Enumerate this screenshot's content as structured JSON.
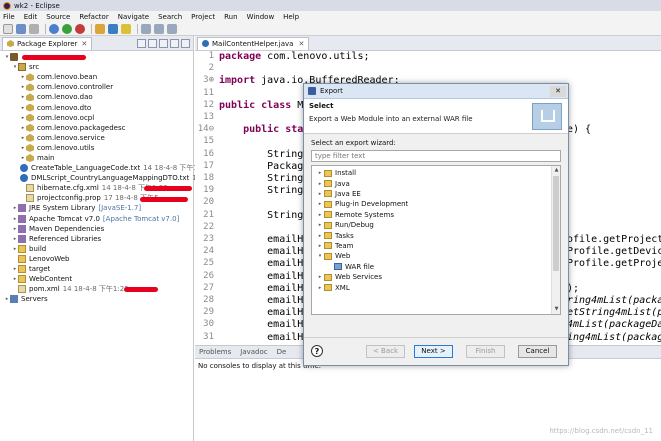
{
  "window": {
    "title": "wk2 - Eclipse"
  },
  "menu": [
    "File",
    "Edit",
    "Source",
    "Refactor",
    "Navigate",
    "Search",
    "Project",
    "Run",
    "Window",
    "Help"
  ],
  "explorer": {
    "tab_label": "Package Explorer",
    "tab_close": "✕",
    "rows": [
      {
        "depth": 0,
        "twisty": "▾",
        "icon": "project",
        "label": "",
        "meta": "",
        "redact": 64
      },
      {
        "depth": 1,
        "twisty": "▾",
        "icon": "src",
        "label": "src",
        "meta": ""
      },
      {
        "depth": 2,
        "twisty": "▸",
        "icon": "pkg",
        "label": "com.lenovo.bean",
        "meta": ""
      },
      {
        "depth": 2,
        "twisty": "▸",
        "icon": "pkg",
        "label": "com.lenovo.controller",
        "meta": ""
      },
      {
        "depth": 2,
        "twisty": "▸",
        "icon": "pkg",
        "label": "com.lenovo.dao",
        "meta": ""
      },
      {
        "depth": 2,
        "twisty": "▸",
        "icon": "pkg",
        "label": "com.lenovo.dto",
        "meta": ""
      },
      {
        "depth": 2,
        "twisty": "▸",
        "icon": "pkg",
        "label": "com.lenovo.ocpl",
        "meta": ""
      },
      {
        "depth": 2,
        "twisty": "▸",
        "icon": "pkg",
        "label": "com.lenovo.packagedesc",
        "meta": ""
      },
      {
        "depth": 2,
        "twisty": "▸",
        "icon": "pkg",
        "label": "com.lenovo.service",
        "meta": ""
      },
      {
        "depth": 2,
        "twisty": "▸",
        "icon": "pkg",
        "label": "com.lenovo.utils",
        "meta": ""
      },
      {
        "depth": 2,
        "twisty": "▸",
        "icon": "pkg",
        "label": "main",
        "meta": ""
      },
      {
        "depth": 2,
        "twisty": "",
        "icon": "java",
        "label": "CreateTable_LanguageCode.txt",
        "meta": "14  18-4-8 下午1:2"
      },
      {
        "depth": 2,
        "twisty": "",
        "icon": "java",
        "label": "DMLScript_CountryLanguageMappingDTO.txt",
        "meta": "14"
      },
      {
        "depth": 2,
        "twisty": "",
        "icon": "xml",
        "label": "hibernate.cfg.xml",
        "meta": "14  18-4-8 下午1:23",
        "redact": 48
      },
      {
        "depth": 2,
        "twisty": "",
        "icon": "xml",
        "label": "projectconfig.prop",
        "meta": "17  18-4-8 下午5",
        "redact": 48
      },
      {
        "depth": 1,
        "twisty": "▸",
        "icon": "lib",
        "label": "JRE System Library",
        "meta": "",
        "libmeta": "[JavaSE-1.7]"
      },
      {
        "depth": 1,
        "twisty": "▸",
        "icon": "lib",
        "label": "Apache Tomcat v7.0",
        "meta": "",
        "libmeta": "[Apache Tomcat v7.0]"
      },
      {
        "depth": 1,
        "twisty": "▸",
        "icon": "lib",
        "label": "Maven Dependencies",
        "meta": ""
      },
      {
        "depth": 1,
        "twisty": "▸",
        "icon": "lib",
        "label": "Referenced Libraries",
        "meta": ""
      },
      {
        "depth": 1,
        "twisty": "▸",
        "icon": "folder",
        "label": "build",
        "meta": ""
      },
      {
        "depth": 1,
        "twisty": "",
        "icon": "folder",
        "label": "LenovoWeb",
        "meta": ""
      },
      {
        "depth": 1,
        "twisty": "▸",
        "icon": "folder",
        "label": "target",
        "meta": ""
      },
      {
        "depth": 1,
        "twisty": "▸",
        "icon": "folder",
        "label": "WebContent",
        "meta": ""
      },
      {
        "depth": 1,
        "twisty": "",
        "icon": "xml",
        "label": "pom.xml",
        "meta": "14  18-4-8 下午1:23",
        "redact": 34
      },
      {
        "depth": 0,
        "twisty": "▸",
        "icon": "server",
        "label": "Servers",
        "meta": ""
      }
    ]
  },
  "editor": {
    "tab_label": "MailContentHelper.java",
    "tab_close": "✕",
    "lines": [
      {
        "num": "1",
        "kw": "package",
        "text": " com.lenovo.utils;"
      },
      {
        "num": "2",
        "kw": "",
        "text": ""
      },
      {
        "num": "3⊕",
        "kw": "import",
        "text": " java.io.BufferedReader;"
      },
      {
        "num": "11",
        "kw": "",
        "text": ""
      },
      {
        "num": "12",
        "kw": "public class",
        "text": " Mai"
      },
      {
        "num": "13",
        "kw": "",
        "text": ""
      },
      {
        "num": "14⊖",
        "kw": "    public stat",
        "text": ""
      },
      {
        "num": "15",
        "kw": "",
        "text": ""
      },
      {
        "num": "16",
        "kw": "",
        "text": "        String p"
      },
      {
        "num": "17",
        "kw": "",
        "text": "        PackageI"
      },
      {
        "num": "18",
        "kw": "",
        "text": "        String c"
      },
      {
        "num": "19",
        "kw": "",
        "text": "        String c"
      },
      {
        "num": "20",
        "kw": "",
        "text": ""
      },
      {
        "num": "21",
        "kw": "",
        "text": "        String c"
      },
      {
        "num": "22",
        "kw": "",
        "text": ""
      },
      {
        "num": "23",
        "kw": "",
        "text": "        emailHtm"
      },
      {
        "num": "24",
        "kw": "",
        "text": "        emailHtm"
      },
      {
        "num": "25",
        "kw": "",
        "text": "        emailHtm"
      },
      {
        "num": "26",
        "kw": "",
        "text": "        emailHtm"
      },
      {
        "num": "27",
        "kw": "",
        "text": "        emailHtm"
      },
      {
        "num": "28",
        "kw": "",
        "text": "        emailHtm"
      },
      {
        "num": "29",
        "kw": "",
        "text": "        emailHtm"
      },
      {
        "num": "30",
        "kw": "",
        "text": "        emailHtm"
      },
      {
        "num": "31",
        "kw": "",
        "text": "        emailHtm"
      }
    ],
    "right_fragments": [
      {
        "line": 6,
        "text": "e) {",
        "italic": false
      },
      {
        "line": 15,
        "text": "ofile.getProjectI",
        "italic": false
      },
      {
        "line": 16,
        "text": "Profile.getDevice",
        "italic": false
      },
      {
        "line": 17,
        "text": "Profile.getProjec",
        "italic": false
      },
      {
        "line": 19,
        "text": ");",
        "italic": false
      },
      {
        "line": 20,
        "text": "ring4mList(packag",
        "italic": true
      },
      {
        "line": 21,
        "text": "etString4mList(pa",
        "italic": true
      },
      {
        "line": 22,
        "text": "4mList(packageDat",
        "italic": true
      },
      {
        "line": 23,
        "text": "ing4mList(package",
        "italic": true
      }
    ]
  },
  "console": {
    "tabs": [
      "Problems",
      "Javadoc",
      "De"
    ],
    "message": "No consoles to display at this time."
  },
  "dialog": {
    "title": "Export",
    "close": "✕",
    "header_title": "Select",
    "header_desc": "Export a Web Module into an external WAR file",
    "select_label": "Select an export wizard:",
    "filter_placeholder": "type filter text",
    "tree": [
      {
        "depth": 0,
        "twisty": "▸",
        "icon": "folder",
        "label": "Install"
      },
      {
        "depth": 0,
        "twisty": "▸",
        "icon": "folder",
        "label": "Java"
      },
      {
        "depth": 0,
        "twisty": "▸",
        "icon": "folder",
        "label": "Java EE"
      },
      {
        "depth": 0,
        "twisty": "▸",
        "icon": "folder",
        "label": "Plug-in Development"
      },
      {
        "depth": 0,
        "twisty": "▸",
        "icon": "folder",
        "label": "Remote Systems"
      },
      {
        "depth": 0,
        "twisty": "▸",
        "icon": "folder",
        "label": "Run/Debug"
      },
      {
        "depth": 0,
        "twisty": "▸",
        "icon": "folder",
        "label": "Tasks"
      },
      {
        "depth": 0,
        "twisty": "▸",
        "icon": "folder",
        "label": "Team"
      },
      {
        "depth": 0,
        "twisty": "▾",
        "icon": "folder",
        "label": "Web"
      },
      {
        "depth": 1,
        "twisty": "",
        "icon": "war",
        "label": "WAR file"
      },
      {
        "depth": 0,
        "twisty": "▸",
        "icon": "folder",
        "label": "Web Services"
      },
      {
        "depth": 0,
        "twisty": "▸",
        "icon": "folder",
        "label": "XML"
      }
    ],
    "buttons": {
      "help": "?",
      "back": "< Back",
      "next": "Next >",
      "finish": "Finish",
      "cancel": "Cancel"
    }
  },
  "watermark": "https://blog.csdn.net/csdn_11",
  "colors": {
    "keyword": "#7f0055",
    "redaction": "#e8001e",
    "dialog_accent": "#2a7ad2"
  }
}
